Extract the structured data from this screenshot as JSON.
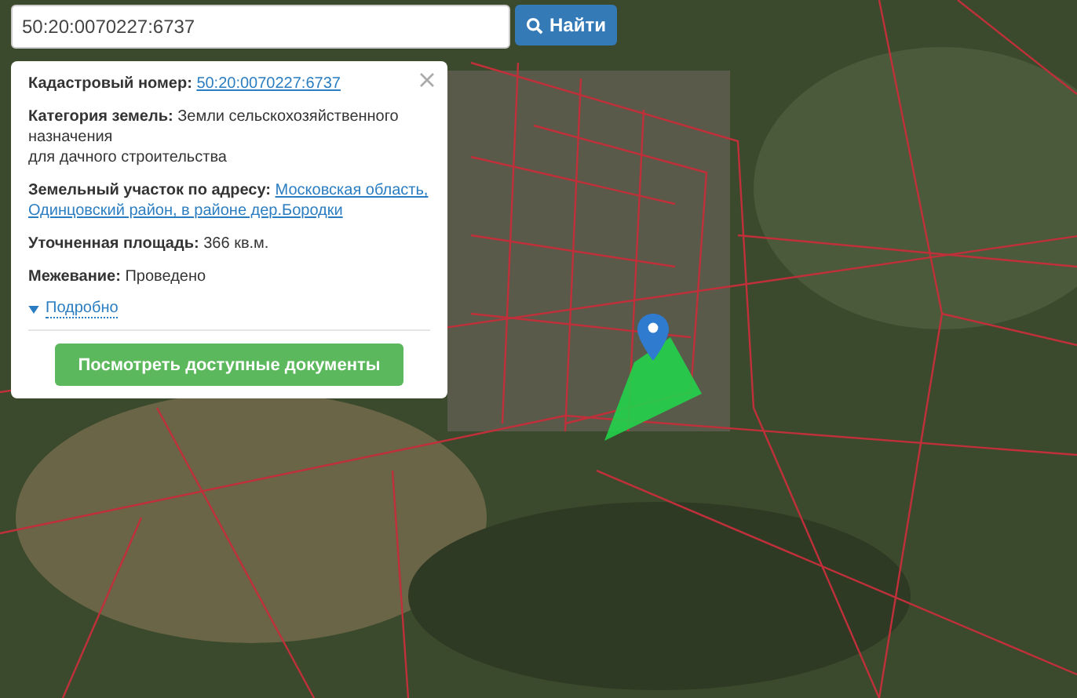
{
  "search": {
    "value": "50:20:0070227:6737",
    "button": "Найти"
  },
  "popup": {
    "fields": [
      {
        "label": "Кадастровый номер:",
        "kind": "link",
        "lines": [
          "50:20:0070227:6737"
        ]
      },
      {
        "label": "Категория земель:",
        "kind": "text",
        "lines": [
          "Земли сельскохозяйственного назначения",
          "для дачного строительства"
        ]
      },
      {
        "label": "Земельный участок по адресу:",
        "kind": "link",
        "lines": [
          "Московская область,",
          "Одинцовский район, в районе дер.Бородки"
        ]
      },
      {
        "label": "Уточненная площадь:",
        "kind": "text",
        "lines": [
          "366 кв.м."
        ]
      },
      {
        "label": "Межевание:",
        "kind": "text",
        "lines": [
          "Проведено"
        ]
      }
    ],
    "details": {
      "label": "Подробно",
      "expanded": false
    },
    "button": "Посмотреть доступные документы"
  }
}
